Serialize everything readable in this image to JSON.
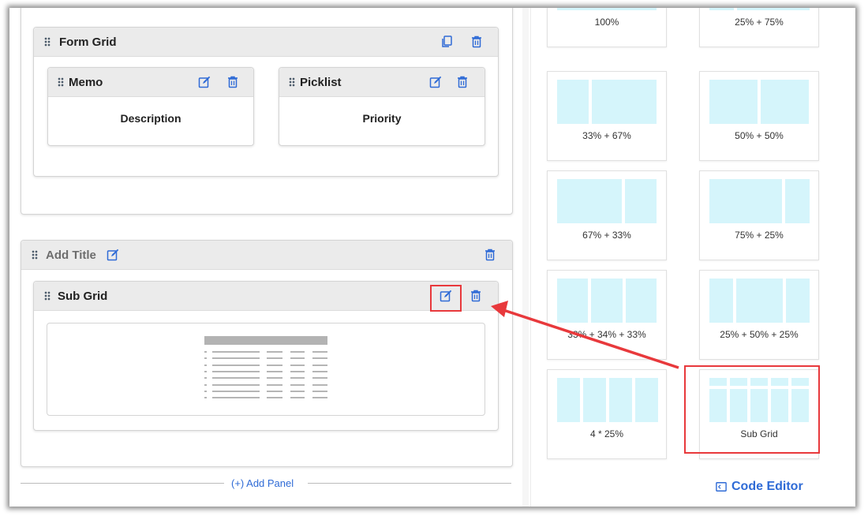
{
  "form_grid": {
    "title": "Form Grid",
    "fields": [
      {
        "type": "Memo",
        "value": "Description"
      },
      {
        "type": "Picklist",
        "value": "Priority"
      }
    ]
  },
  "add_title_panel": {
    "title": "Add Title",
    "sub_grid": {
      "title": "Sub Grid"
    }
  },
  "add_panel_label": "(+) Add Panel",
  "layouts": [
    {
      "label": "100%",
      "widths": [
        100
      ]
    },
    {
      "label": "25% + 75%",
      "widths": [
        25,
        75
      ]
    },
    {
      "label": "33% + 67%",
      "widths": [
        33,
        67
      ]
    },
    {
      "label": "50% + 50%",
      "widths": [
        50,
        50
      ]
    },
    {
      "label": "67% + 33%",
      "widths": [
        67,
        33
      ]
    },
    {
      "label": "75% + 25%",
      "widths": [
        75,
        25
      ]
    },
    {
      "label": "33% + 34% + 33%",
      "widths": [
        33,
        34,
        33
      ]
    },
    {
      "label": "25% + 50% + 25%",
      "widths": [
        25,
        50,
        25
      ]
    },
    {
      "label": "4 * 25%",
      "widths": [
        25,
        25,
        25,
        25
      ]
    },
    {
      "label": "Sub Grid",
      "widths": [
        20,
        20,
        20,
        20,
        20
      ]
    }
  ],
  "code_editor_label": "Code Editor",
  "colors": {
    "accent": "#2f6bd6",
    "highlight": "#e8393c",
    "cell": "#d5f5fb"
  }
}
